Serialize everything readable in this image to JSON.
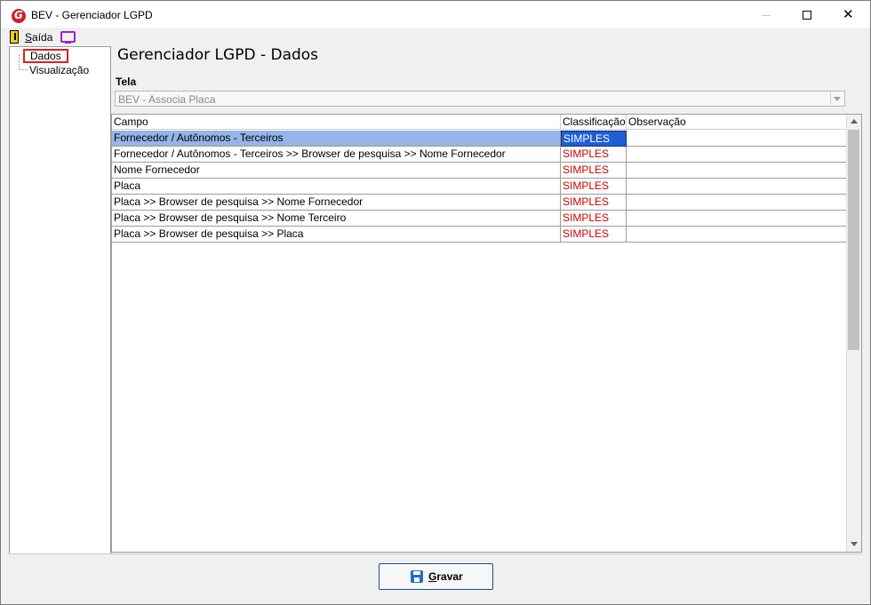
{
  "window": {
    "title": "BEV - Gerenciador LGPD"
  },
  "menu": {
    "exit_first": "S",
    "exit_rest": "aída"
  },
  "tree": {
    "items": [
      {
        "label": "Dados"
      },
      {
        "label": "Visualização"
      }
    ]
  },
  "main": {
    "title": "Gerenciador LGPD - Dados",
    "tela_label": "Tela",
    "tela_value": "BEV - Associa Placa"
  },
  "grid": {
    "columns": [
      "Campo",
      "Classificação",
      "Observação"
    ],
    "rows": [
      {
        "campo": "Fornecedor / Autônomos - Terceiros",
        "classificacao": "SIMPLES",
        "observacao": ""
      },
      {
        "campo": "Fornecedor / Autônomos - Terceiros >> Browser de pesquisa >> Nome Fornecedor",
        "classificacao": "SIMPLES",
        "observacao": ""
      },
      {
        "campo": "Nome Fornecedor",
        "classificacao": "SIMPLES",
        "observacao": ""
      },
      {
        "campo": "Placa",
        "classificacao": "SIMPLES",
        "observacao": ""
      },
      {
        "campo": "Placa >> Browser de pesquisa >> Nome Fornecedor",
        "classificacao": "SIMPLES",
        "observacao": ""
      },
      {
        "campo": "Placa >> Browser de pesquisa >> Nome Terceiro",
        "classificacao": "SIMPLES",
        "observacao": ""
      },
      {
        "campo": "Placa >> Browser de pesquisa >> Placa",
        "classificacao": "SIMPLES",
        "observacao": ""
      }
    ]
  },
  "footer": {
    "save_first": "G",
    "save_rest": "ravar"
  },
  "colors": {
    "selection_row": "#95b4e8",
    "selection_cell": "#1f5fd6",
    "classification_text": "#d00000",
    "highlight_border": "#e02020"
  }
}
